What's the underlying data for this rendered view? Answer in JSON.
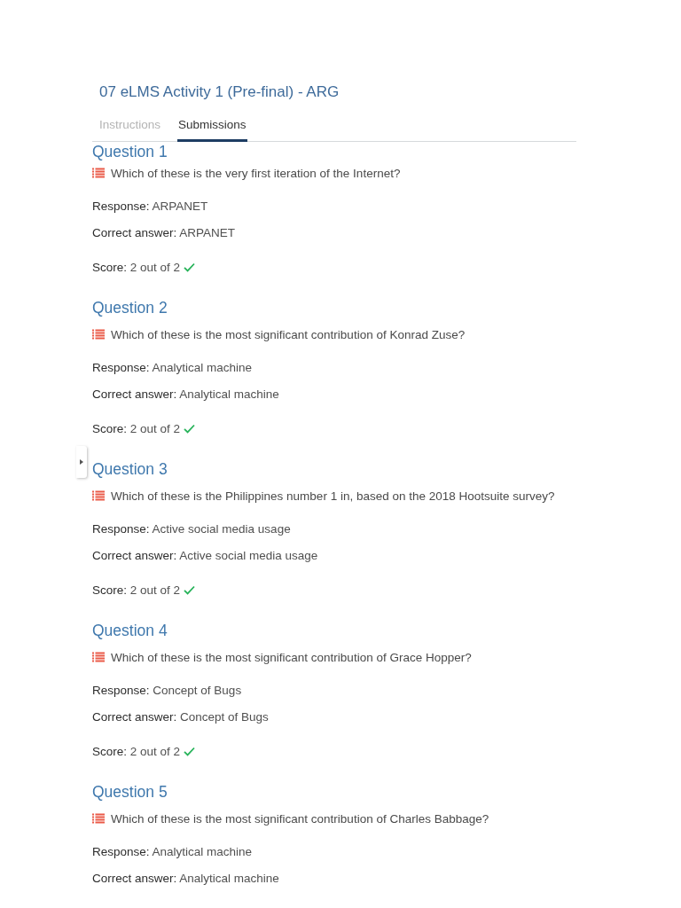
{
  "title": "07 eLMS Activity 1 (Pre-final) - ARG",
  "tabs": [
    {
      "label": "Instructions",
      "selected": false
    },
    {
      "label": "Submissions",
      "selected": true
    }
  ],
  "questions": [
    {
      "heading": "Question 1",
      "text": "Which of these is the very first iteration of the Internet?",
      "response": {
        "label": "Response:",
        "value": "ARPANET"
      },
      "correct_answer": {
        "label": "Correct answer:",
        "value": "ARPANET"
      },
      "score": {
        "label": "Score:",
        "value": "2 out of 2",
        "correct": true
      }
    },
    {
      "heading": "Question 2",
      "text": "Which of these is the most significant contribution of Konrad Zuse?",
      "response": {
        "label": "Response:",
        "value": "Analytical machine"
      },
      "correct_answer": {
        "label": "Correct answer:",
        "value": "Analytical machine"
      },
      "score": {
        "label": "Score:",
        "value": "2 out of 2",
        "correct": true
      }
    },
    {
      "heading": "Question 3",
      "text": "Which of these is the Philippines number 1 in, based on the 2018 Hootsuite survey?",
      "response": {
        "label": "Response:",
        "value": "Active social media usage"
      },
      "correct_answer": {
        "label": "Correct answer:",
        "value": "Active social media usage"
      },
      "score": {
        "label": "Score:",
        "value": "2 out of 2",
        "correct": true
      }
    },
    {
      "heading": "Question 4",
      "text": "Which of these is the most significant contribution of Grace Hopper?",
      "response": {
        "label": "Response:",
        "value": "Concept of Bugs"
      },
      "correct_answer": {
        "label": "Correct answer:",
        "value": "Concept of Bugs"
      },
      "score": {
        "label": "Score:",
        "value": "2 out of 2",
        "correct": true
      }
    },
    {
      "heading": "Question 5",
      "text": "Which of these is the most significant contribution of Charles Babbage?",
      "response": {
        "label": "Response:",
        "value": "Analytical machine"
      },
      "correct_answer": {
        "label": "Correct answer:",
        "value": "Analytical machine"
      }
    }
  ]
}
